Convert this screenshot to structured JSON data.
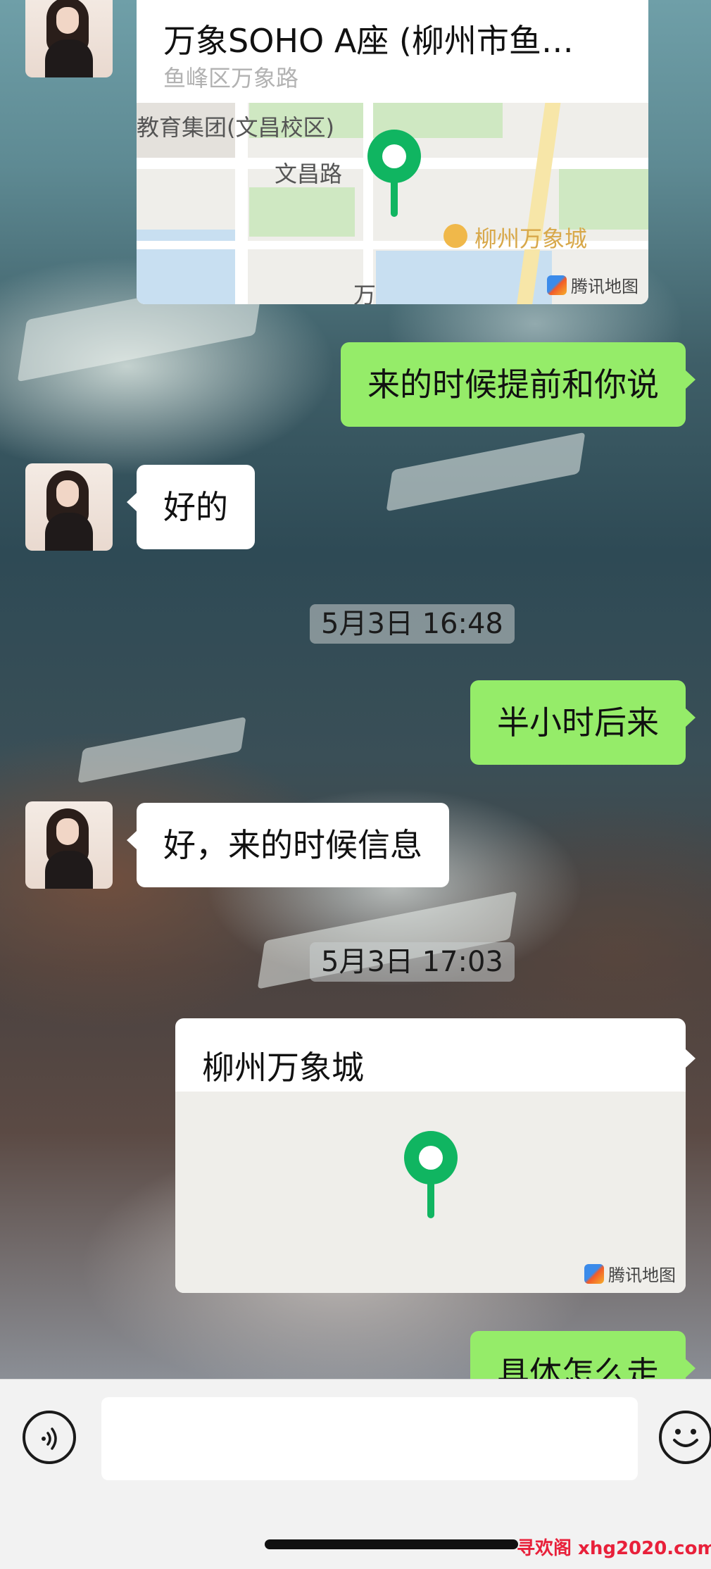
{
  "messages": {
    "location_top": {
      "title": "万象SOHO A座 (柳州市鱼…",
      "subtitle": "鱼峰区万象路",
      "map_labels": [
        "教育集团(文昌校区)",
        "文昌路",
        "柳州万象城",
        "万"
      ],
      "brand": "腾讯地图"
    },
    "out_1": "来的时候提前和你说",
    "in_1": "好的",
    "time_1": "5月3日 16:48",
    "out_2": "半小时后来",
    "in_2": "好，来的时候信息",
    "time_2": "5月3日 17:03",
    "location_bottom": {
      "title": "柳州万象城",
      "brand": "腾讯地图"
    },
    "out_3_partial": "具体怎么走"
  },
  "input_bar": {
    "text_value": "",
    "voice_icon": "voice-icon",
    "emoji_icon": "emoji-icon"
  },
  "watermark": "寻欢阁 xhg2020.com",
  "colors": {
    "bubble_out": "#95ec69",
    "bubble_in": "#ffffff",
    "pin": "#10b561"
  }
}
